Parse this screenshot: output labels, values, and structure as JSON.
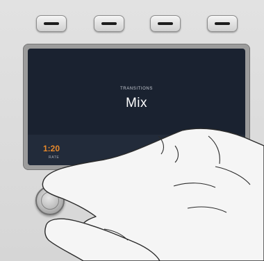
{
  "display": {
    "category": "TRANSITIONS",
    "title": "Mix",
    "rate_value": "1:20",
    "rate_label": "RATE"
  },
  "colors": {
    "screen_bg": "#1a2230",
    "rate_accent": "#e8892b",
    "panel": "#d9d9d9"
  },
  "controls": {
    "soft_buttons": 4,
    "knobs": 2
  }
}
